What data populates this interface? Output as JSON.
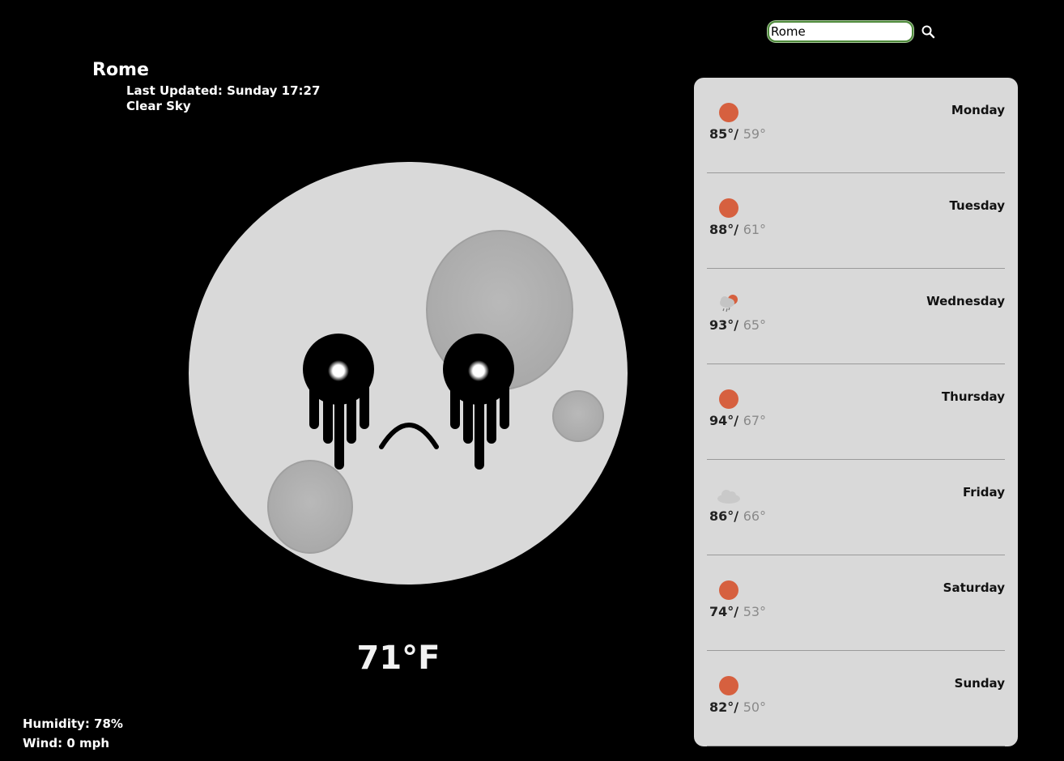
{
  "search": {
    "value": "Rome"
  },
  "current": {
    "city": "Rome",
    "last_updated": "Last Updated: Sunday 17:27",
    "condition": "Clear Sky",
    "temperature": "71°F",
    "humidity": "Humidity: 78%",
    "wind": "Wind: 0 mph"
  },
  "forecast": [
    {
      "day": "Monday",
      "high": "85°",
      "low": "59°",
      "icon": "sun-icon"
    },
    {
      "day": "Tuesday",
      "high": "88°",
      "low": "61°",
      "icon": "sun-icon"
    },
    {
      "day": "Wednesday",
      "high": "93°",
      "low": "65°",
      "icon": "rain-sun-icon"
    },
    {
      "day": "Thursday",
      "high": "94°",
      "low": "67°",
      "icon": "sun-icon"
    },
    {
      "day": "Friday",
      "high": "86°",
      "low": "66°",
      "icon": "cloud-icon"
    },
    {
      "day": "Saturday",
      "high": "74°",
      "low": "53°",
      "icon": "sun-icon"
    },
    {
      "day": "Sunday",
      "high": "82°",
      "low": "50°",
      "icon": "sun-icon"
    }
  ],
  "colors": {
    "sun": "#d6603f",
    "panel": "#d9d9d9",
    "moon": "#d9d9d9"
  }
}
